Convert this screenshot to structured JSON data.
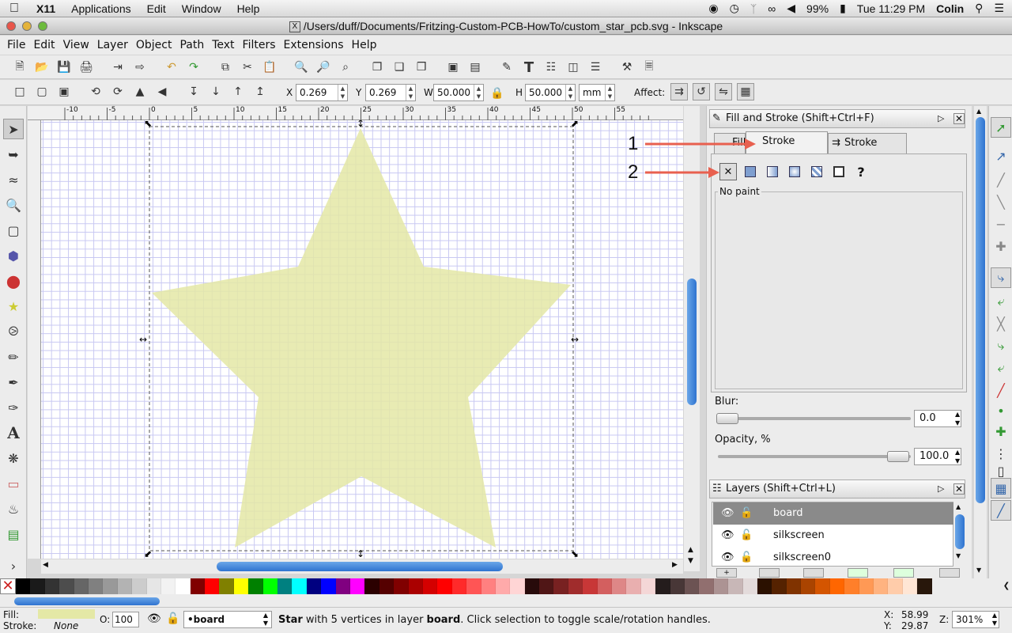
{
  "macbar": {
    "app": "X11",
    "menus": [
      "Applications",
      "Edit",
      "Window",
      "Help"
    ],
    "battery": "99%",
    "time": "Tue 11:29 PM",
    "user": "Colin"
  },
  "window": {
    "title": "/Users/duff/Documents/Fritzing-Custom-PCB-HowTo/custom_star_pcb.svg - Inkscape"
  },
  "menubar": [
    "File",
    "Edit",
    "View",
    "Layer",
    "Object",
    "Path",
    "Text",
    "Filters",
    "Extensions",
    "Help"
  ],
  "controls": {
    "x_label": "X",
    "x_value": "0.269",
    "y_label": "Y",
    "y_value": "0.269",
    "w_label": "W",
    "w_value": "50.000",
    "h_label": "H",
    "h_value": "50.000",
    "unit": "mm",
    "affect_label": "Affect:"
  },
  "ruler": {
    "top_ticks": [
      "-10",
      "-5",
      "0",
      "5",
      "10",
      "15",
      "20",
      "25",
      "30",
      "35",
      "40",
      "45",
      "50",
      "55"
    ]
  },
  "fill_stroke": {
    "title": "Fill and Stroke (Shift+Ctrl+F)",
    "tabs": [
      "Fill",
      "Stroke paint",
      "Stroke style"
    ],
    "active_tab": "Stroke paint",
    "paint_mode": "No paint",
    "blur_label": "Blur:",
    "blur_value": "0.0",
    "opacity_label": "Opacity, %",
    "opacity_value": "100.0"
  },
  "annotations": {
    "one": "1",
    "two": "2"
  },
  "layers": {
    "title": "Layers (Shift+Ctrl+L)",
    "items": [
      {
        "name": "board",
        "selected": true
      },
      {
        "name": "silkscreen",
        "selected": false
      },
      {
        "name": "silkscreen0",
        "selected": false
      }
    ]
  },
  "palette": [
    "#000000",
    "#1a1a1a",
    "#333333",
    "#4d4d4d",
    "#666666",
    "#808080",
    "#999999",
    "#b3b3b3",
    "#cccccc",
    "#e6e6e6",
    "#f2f2f2",
    "#ffffff",
    "#800000",
    "#ff0000",
    "#808000",
    "#ffff00",
    "#008000",
    "#00ff00",
    "#008080",
    "#00ffff",
    "#000080",
    "#0000ff",
    "#800080",
    "#ff00ff",
    "#2b0000",
    "#550000",
    "#800000",
    "#aa0000",
    "#d40000",
    "#ff0000",
    "#ff2a2a",
    "#ff5555",
    "#ff8080",
    "#ffaaaa",
    "#ffd5d5",
    "#280b0b",
    "#501616",
    "#782121",
    "#a02c2c",
    "#c83737",
    "#d35f5f",
    "#de8787",
    "#e9afaf",
    "#f4d7d7",
    "#241c1c",
    "#483737",
    "#6c5353",
    "#916f6f",
    "#ac9393",
    "#c8b7b7",
    "#e3dbdb",
    "#2b1100",
    "#552200",
    "#803300",
    "#aa4400",
    "#d45500",
    "#ff6600",
    "#ff7f2a",
    "#ff9955",
    "#ffb380",
    "#ffccaa",
    "#ffe6d5",
    "#28170b"
  ],
  "status": {
    "fill_label": "Fill:",
    "stroke_label": "Stroke:",
    "stroke_value": "None",
    "opacity_label": "O:",
    "opacity_value": "100",
    "layer": "•board",
    "message_bold1": "Star",
    "message_mid": " with 5 vertices in layer ",
    "message_bold2": "board",
    "message_end": ". Click selection to toggle scale/rotation handles.",
    "x_label": "X:",
    "x_value": "58.99",
    "y_label": "Y:",
    "y_value": "29.87",
    "zoom_label": "Z:",
    "zoom_value": "301%"
  },
  "colors": {
    "star_fill": "#e4e8a6",
    "grid": "#c8c8f2",
    "arrow": "#e8604f"
  }
}
